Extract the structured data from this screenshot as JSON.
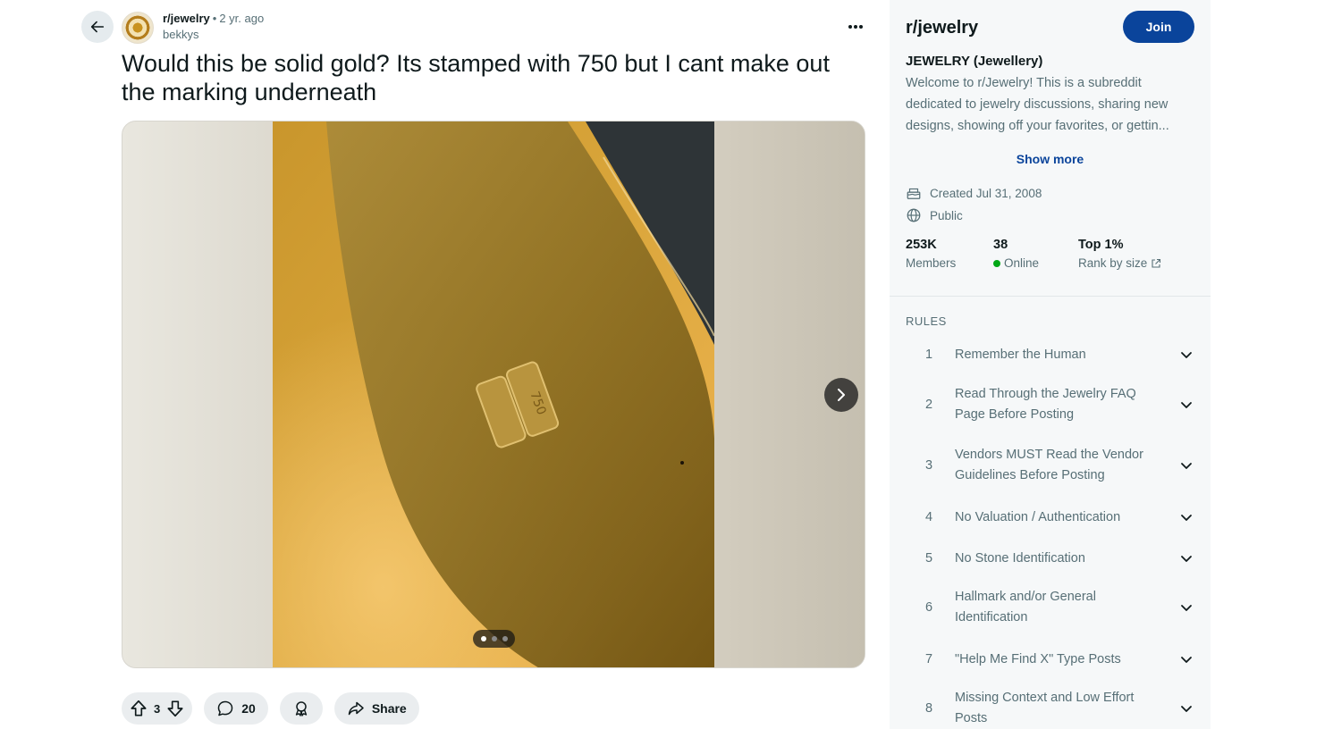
{
  "post": {
    "subreddit": "r/jewelry",
    "separator": "•",
    "age": "2 yr. ago",
    "author": "bekkys",
    "title": "Would this be solid gold? Its stamped with 750 but I cant make out the marking underneath",
    "gallery": {
      "current_image": 1,
      "total_images": 3
    },
    "actions": {
      "vote_count": "3",
      "comment_count": "20",
      "share_label": "Share"
    }
  },
  "sidebar": {
    "title": "r/jewelry",
    "join_label": "Join",
    "heading": "JEWELRY (Jewellery)",
    "description": "Welcome to r/Jewelry! This is a subreddit dedicated to jewelry discussions, sharing new designs, showing off your favorites, or gettin...",
    "show_more": "Show more",
    "created": "Created Jul 31, 2008",
    "visibility": "Public",
    "stats": [
      {
        "value": "253K",
        "label": "Members"
      },
      {
        "value": "38",
        "label": "Online"
      },
      {
        "value": "Top 1%",
        "label": "Rank by size"
      }
    ],
    "rules_heading": "RULES",
    "rules": [
      {
        "num": "1",
        "text": "Remember the Human"
      },
      {
        "num": "2",
        "text": "Read Through the Jewelry FAQ Page Before Posting"
      },
      {
        "num": "3",
        "text": "Vendors MUST Read the Vendor Guidelines Before Posting"
      },
      {
        "num": "4",
        "text": "No Valuation / Authentication"
      },
      {
        "num": "5",
        "text": "No Stone Identification"
      },
      {
        "num": "6",
        "text": "Hallmark and/or General Identification"
      },
      {
        "num": "7",
        "text": "\"Help Me Find X\" Type Posts"
      },
      {
        "num": "8",
        "text": "Missing Context and Low Effort Posts"
      }
    ]
  },
  "colors": {
    "accent": "#0a449b",
    "online": "#01a816",
    "muted_text": "#576f76",
    "sidebar_bg": "#f6f8f9",
    "pill_bg": "#eaedef"
  },
  "icons": [
    "arrow-left-icon",
    "more-horizontal-icon",
    "chevron-right-icon",
    "upvote-icon",
    "downvote-icon",
    "comment-icon",
    "award-icon",
    "share-icon",
    "cake-icon",
    "globe-icon",
    "external-link-icon",
    "chevron-down-icon"
  ]
}
